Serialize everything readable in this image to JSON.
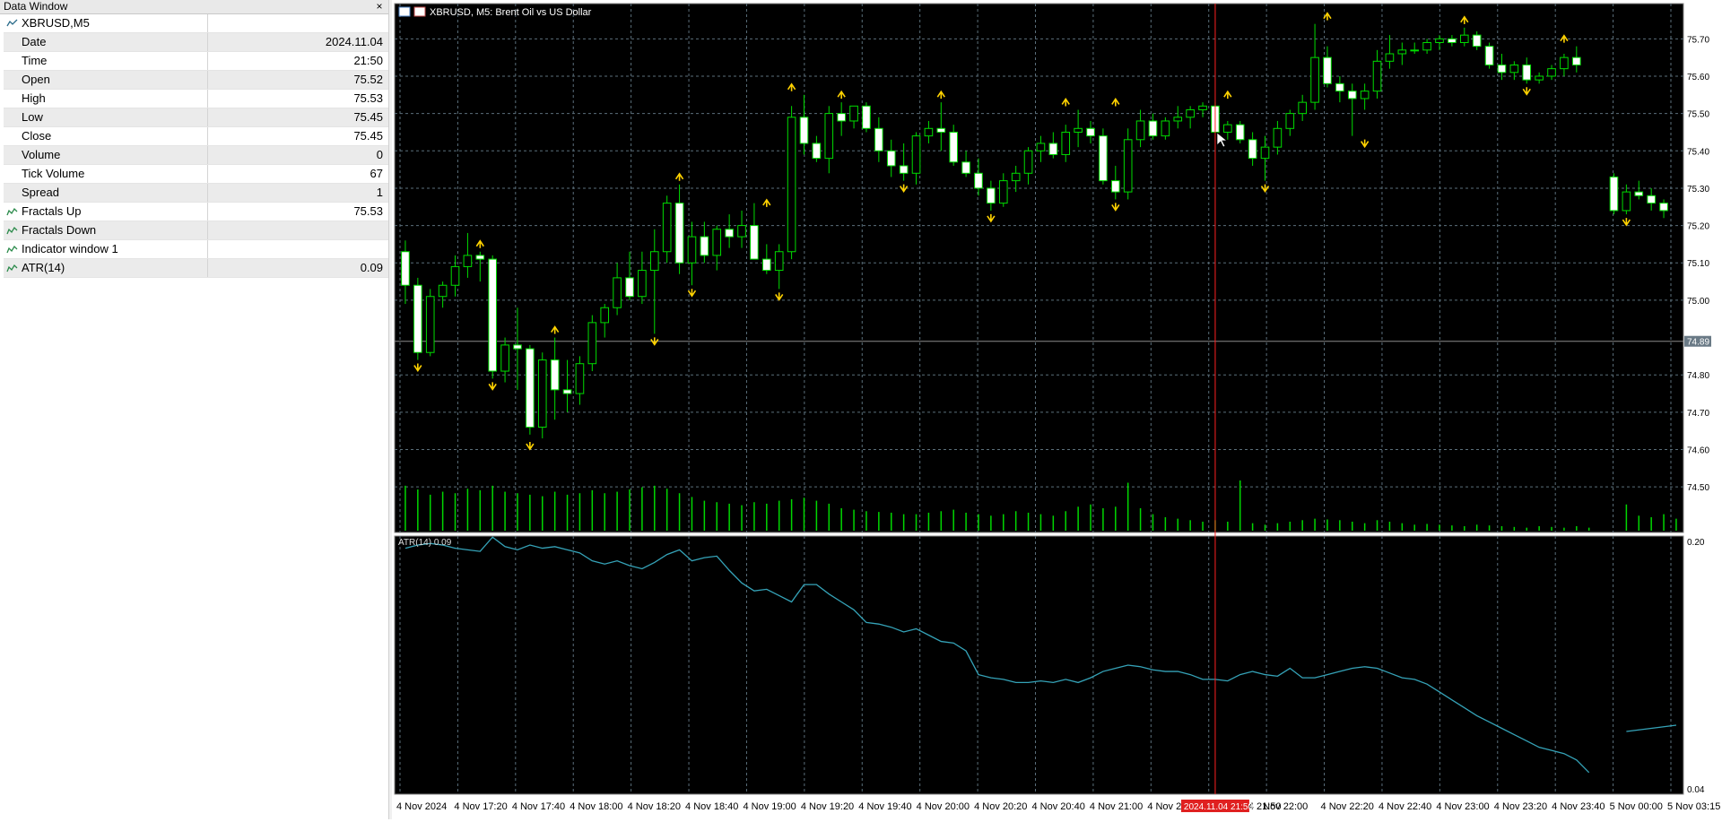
{
  "data_window": {
    "title": "Data Window",
    "close_glyph": "×",
    "symbol": "XBRUSD,M5",
    "rows": [
      {
        "label": "Date",
        "value": "2024.11.04",
        "icon": ""
      },
      {
        "label": "Time",
        "value": "21:50",
        "icon": ""
      },
      {
        "label": "Open",
        "value": "75.52",
        "icon": ""
      },
      {
        "label": "High",
        "value": "75.53",
        "icon": ""
      },
      {
        "label": "Low",
        "value": "75.45",
        "icon": ""
      },
      {
        "label": "Close",
        "value": "75.45",
        "icon": ""
      },
      {
        "label": "Volume",
        "value": "0",
        "icon": ""
      },
      {
        "label": "Tick Volume",
        "value": "67",
        "icon": ""
      },
      {
        "label": "Spread",
        "value": "1",
        "icon": ""
      },
      {
        "label": "Fractals Up",
        "value": "75.53",
        "icon": "indicator-icon"
      },
      {
        "label": "Fractals Down",
        "value": "",
        "icon": "indicator-icon"
      },
      {
        "label": "Indicator window 1",
        "value": "",
        "icon": "indicator-icon"
      },
      {
        "label": "ATR(14)",
        "value": "0.09",
        "icon": "indicator-icon"
      }
    ]
  },
  "chart": {
    "title": "XBRUSD, M5:  Brent Oil vs US Dollar",
    "price_labels": [
      "75.70",
      "75.60",
      "75.50",
      "75.40",
      "75.30",
      "75.20",
      "75.10",
      "75.00",
      "74.89",
      "74.80",
      "74.70",
      "74.60",
      "74.50"
    ],
    "current_price_label": "74.89",
    "time_labels": [
      "4 Nov 2024",
      "4 Nov 17:20",
      "4 Nov 17:40",
      "4 Nov 18:00",
      "4 Nov 18:20",
      "4 Nov 18:40",
      "4 Nov 19:00",
      "4 Nov 19:20",
      "4 Nov 19:40",
      "4 Nov 20:00",
      "4 Nov 20:20",
      "4 Nov 20:40",
      "4 Nov 21:00",
      "4 Nov 21:20",
      "2024.11.04 21:50",
      "Nov 22:00",
      "4 Nov 22:20",
      "4 Nov 22:40",
      "4 Nov 23:00",
      "4 Nov 23:20",
      "4 Nov 23:40",
      "5 Nov 00:00",
      "5 Nov 03:15"
    ],
    "crosshair_time_label": "2024.11.04 21:50",
    "atr_label": "ATR(14) 0.09",
    "atr_scale": [
      "0.20",
      "0.04"
    ],
    "colors": {
      "background": "#000000",
      "grid": "#5b6f7b",
      "bull": "#00dc00",
      "bear_body": "#ffffff",
      "volume": "#00d700",
      "fractal": "#ffd200",
      "atr": "#35a3b8",
      "crosshair": "#ff2020"
    }
  },
  "chart_data": {
    "type": "candlestick",
    "title": "XBRUSD, M5: Brent Oil vs US Dollar",
    "ylim": [
      74.45,
      75.78
    ],
    "candles": [
      [
        75.13,
        75.16,
        74.99,
        75.04
      ],
      [
        75.04,
        75.06,
        74.84,
        74.86
      ],
      [
        74.86,
        75.03,
        74.85,
        75.01
      ],
      [
        75.01,
        75.05,
        74.98,
        75.04
      ],
      [
        75.04,
        75.12,
        75.01,
        75.09
      ],
      [
        75.09,
        75.18,
        75.06,
        75.12
      ],
      [
        75.12,
        75.13,
        75.05,
        75.11
      ],
      [
        75.11,
        75.12,
        74.79,
        74.81
      ],
      [
        74.81,
        74.9,
        74.78,
        74.88
      ],
      [
        74.88,
        74.98,
        74.76,
        74.87
      ],
      [
        74.87,
        74.88,
        74.64,
        74.66
      ],
      [
        74.66,
        74.86,
        74.63,
        74.84
      ],
      [
        74.84,
        74.9,
        74.68,
        74.76
      ],
      [
        74.76,
        74.84,
        74.7,
        74.75
      ],
      [
        74.75,
        74.85,
        74.72,
        74.83
      ],
      [
        74.83,
        74.96,
        74.81,
        74.94
      ],
      [
        74.94,
        74.99,
        74.9,
        74.98
      ],
      [
        74.98,
        75.1,
        74.96,
        75.06
      ],
      [
        75.06,
        75.13,
        75.0,
        75.01
      ],
      [
        75.01,
        75.13,
        74.99,
        75.08
      ],
      [
        75.08,
        75.19,
        74.91,
        75.13
      ],
      [
        75.13,
        75.28,
        75.1,
        75.26
      ],
      [
        75.26,
        75.31,
        75.07,
        75.1
      ],
      [
        75.1,
        75.21,
        75.04,
        75.17
      ],
      [
        75.17,
        75.21,
        75.1,
        75.12
      ],
      [
        75.12,
        75.2,
        75.08,
        75.19
      ],
      [
        75.19,
        75.23,
        75.14,
        75.17
      ],
      [
        75.17,
        75.24,
        75.14,
        75.2
      ],
      [
        75.2,
        75.26,
        75.12,
        75.11
      ],
      [
        75.11,
        75.15,
        75.07,
        75.08
      ],
      [
        75.08,
        75.15,
        75.03,
        75.13
      ],
      [
        75.13,
        75.52,
        75.11,
        75.49
      ],
      [
        75.49,
        75.55,
        75.39,
        75.42
      ],
      [
        75.42,
        75.44,
        75.37,
        75.38
      ],
      [
        75.38,
        75.52,
        75.34,
        75.5
      ],
      [
        75.5,
        75.53,
        75.44,
        75.48
      ],
      [
        75.48,
        75.52,
        75.46,
        75.52
      ],
      [
        75.52,
        75.53,
        75.45,
        75.46
      ],
      [
        75.46,
        75.49,
        75.37,
        75.4
      ],
      [
        75.4,
        75.43,
        75.33,
        75.36
      ],
      [
        75.36,
        75.42,
        75.32,
        75.34
      ],
      [
        75.34,
        75.45,
        75.31,
        75.44
      ],
      [
        75.44,
        75.48,
        75.42,
        75.46
      ],
      [
        75.46,
        75.53,
        75.4,
        75.45
      ],
      [
        75.45,
        75.47,
        75.36,
        75.37
      ],
      [
        75.37,
        75.4,
        75.33,
        75.34
      ],
      [
        75.34,
        75.38,
        75.28,
        75.3
      ],
      [
        75.3,
        75.32,
        75.24,
        75.26
      ],
      [
        75.26,
        75.34,
        75.25,
        75.32
      ],
      [
        75.32,
        75.36,
        75.29,
        75.34
      ],
      [
        75.34,
        75.41,
        75.31,
        75.4
      ],
      [
        75.4,
        75.44,
        75.37,
        75.42
      ],
      [
        75.42,
        75.45,
        75.38,
        75.39
      ],
      [
        75.39,
        75.47,
        75.37,
        75.45
      ],
      [
        75.45,
        75.51,
        75.41,
        75.46
      ],
      [
        75.46,
        75.48,
        75.42,
        75.44
      ],
      [
        75.44,
        75.46,
        75.31,
        75.32
      ],
      [
        75.32,
        75.36,
        75.27,
        75.29
      ],
      [
        75.29,
        75.46,
        75.27,
        75.43
      ],
      [
        75.43,
        75.51,
        75.41,
        75.48
      ],
      [
        75.48,
        75.5,
        75.43,
        75.44
      ],
      [
        75.44,
        75.49,
        75.43,
        75.48
      ],
      [
        75.48,
        75.52,
        75.46,
        75.49
      ],
      [
        75.49,
        75.52,
        75.46,
        75.51
      ],
      [
        75.51,
        75.53,
        75.49,
        75.52
      ],
      [
        75.52,
        75.53,
        75.45,
        75.45
      ],
      [
        75.45,
        75.48,
        75.43,
        75.47
      ],
      [
        75.47,
        75.48,
        75.42,
        75.43
      ],
      [
        75.43,
        75.45,
        75.36,
        75.38
      ],
      [
        75.38,
        75.44,
        75.32,
        75.41
      ],
      [
        75.41,
        75.48,
        75.39,
        75.46
      ],
      [
        75.46,
        75.51,
        75.44,
        75.5
      ],
      [
        75.5,
        75.55,
        75.48,
        75.53
      ],
      [
        75.53,
        75.74,
        75.51,
        75.65
      ],
      [
        75.65,
        75.68,
        75.57,
        75.58
      ],
      [
        75.58,
        75.6,
        75.53,
        75.56
      ],
      [
        75.56,
        75.58,
        75.44,
        75.54
      ],
      [
        75.54,
        75.58,
        75.51,
        75.56
      ],
      [
        75.56,
        75.67,
        75.54,
        75.64
      ],
      [
        75.64,
        75.71,
        75.62,
        75.66
      ],
      [
        75.66,
        75.69,
        75.63,
        75.67
      ],
      [
        75.67,
        75.69,
        75.66,
        75.67
      ],
      [
        75.67,
        75.7,
        75.66,
        75.69
      ],
      [
        75.69,
        75.71,
        75.67,
        75.7
      ],
      [
        75.7,
        75.71,
        75.68,
        75.69
      ],
      [
        75.69,
        75.73,
        75.68,
        75.71
      ],
      [
        75.71,
        75.72,
        75.67,
        75.68
      ],
      [
        75.68,
        75.69,
        75.62,
        75.63
      ],
      [
        75.63,
        75.66,
        75.59,
        75.61
      ],
      [
        75.61,
        75.64,
        75.59,
        75.63
      ],
      [
        75.63,
        75.65,
        75.58,
        75.59
      ],
      [
        75.59,
        75.61,
        75.58,
        75.6
      ],
      [
        75.6,
        75.63,
        75.59,
        75.62
      ],
      [
        75.62,
        75.66,
        75.6,
        75.65
      ],
      [
        75.65,
        75.68,
        75.61,
        75.63
      ],
      null,
      null,
      [
        75.33,
        75.34,
        75.23,
        75.24
      ],
      [
        75.24,
        75.31,
        75.23,
        75.29
      ],
      [
        75.29,
        75.32,
        75.27,
        75.28
      ],
      [
        75.28,
        75.3,
        75.24,
        75.26
      ],
      [
        75.26,
        75.27,
        75.22,
        75.24
      ]
    ],
    "tick_volume": [
      60,
      55,
      48,
      52,
      50,
      56,
      54,
      60,
      52,
      50,
      48,
      46,
      52,
      48,
      50,
      54,
      50,
      52,
      55,
      58,
      60,
      56,
      50,
      45,
      40,
      38,
      36,
      34,
      38,
      36,
      40,
      42,
      44,
      40,
      36,
      30,
      28,
      26,
      25,
      24,
      22,
      22,
      24,
      26,
      28,
      24,
      22,
      20,
      22,
      26,
      24,
      22,
      20,
      26,
      32,
      35,
      30,
      32,
      64,
      30,
      22,
      18,
      16,
      14,
      12,
      14,
      12,
      67,
      10,
      8,
      10,
      12,
      14,
      16,
      15,
      14,
      12,
      10,
      14,
      12,
      10,
      8,
      9,
      8,
      7,
      6,
      8,
      7,
      6,
      5,
      4,
      6,
      5,
      4,
      6,
      4,
      0,
      0,
      35,
      20,
      18,
      22,
      16
    ],
    "atr": [
      0.194,
      0.196,
      0.197,
      0.196,
      0.194,
      0.193,
      0.192,
      0.201,
      0.195,
      0.193,
      0.196,
      0.194,
      0.195,
      0.193,
      0.191,
      0.186,
      0.184,
      0.186,
      0.183,
      0.181,
      0.185,
      0.19,
      0.193,
      0.186,
      0.188,
      0.189,
      0.18,
      0.172,
      0.167,
      0.168,
      0.164,
      0.16,
      0.171,
      0.171,
      0.165,
      0.16,
      0.155,
      0.147,
      0.146,
      0.144,
      0.141,
      0.143,
      0.139,
      0.135,
      0.134,
      0.129,
      0.114,
      0.112,
      0.111,
      0.109,
      0.109,
      0.11,
      0.109,
      0.111,
      0.109,
      0.112,
      0.116,
      0.118,
      0.12,
      0.119,
      0.117,
      0.116,
      0.116,
      0.114,
      0.111,
      0.111,
      0.11,
      0.114,
      0.116,
      0.114,
      0.113,
      0.118,
      0.112,
      0.112,
      0.114,
      0.116,
      0.118,
      0.119,
      0.118,
      0.115,
      0.112,
      0.111,
      0.108,
      0.103,
      0.098,
      0.093,
      0.088,
      0.084,
      0.08,
      0.076,
      0.072,
      0.068,
      0.066,
      0.064,
      0.06,
      0.052,
      null,
      null,
      0.078,
      0.079,
      0.08,
      0.081,
      0.082
    ],
    "fractals_up": [
      [
        6,
        75.13
      ],
      [
        12,
        74.9
      ],
      [
        22,
        75.31
      ],
      [
        29,
        75.24
      ],
      [
        31,
        75.55
      ],
      [
        35,
        75.53
      ],
      [
        43,
        75.53
      ],
      [
        53,
        75.51
      ],
      [
        57,
        75.51
      ],
      [
        66,
        75.53
      ],
      [
        74,
        75.74
      ],
      [
        85,
        75.73
      ],
      [
        93,
        75.68
      ]
    ],
    "fractals_down": [
      [
        1,
        74.84
      ],
      [
        7,
        74.79
      ],
      [
        10,
        74.63
      ],
      [
        20,
        74.91
      ],
      [
        23,
        75.04
      ],
      [
        30,
        75.03
      ],
      [
        40,
        75.32
      ],
      [
        47,
        75.24
      ],
      [
        57,
        75.27
      ],
      [
        69,
        75.32
      ],
      [
        77,
        75.44
      ],
      [
        90,
        75.58
      ],
      [
        98,
        75.23
      ]
    ],
    "atr_ylim": [
      0.04,
      0.2
    ]
  }
}
